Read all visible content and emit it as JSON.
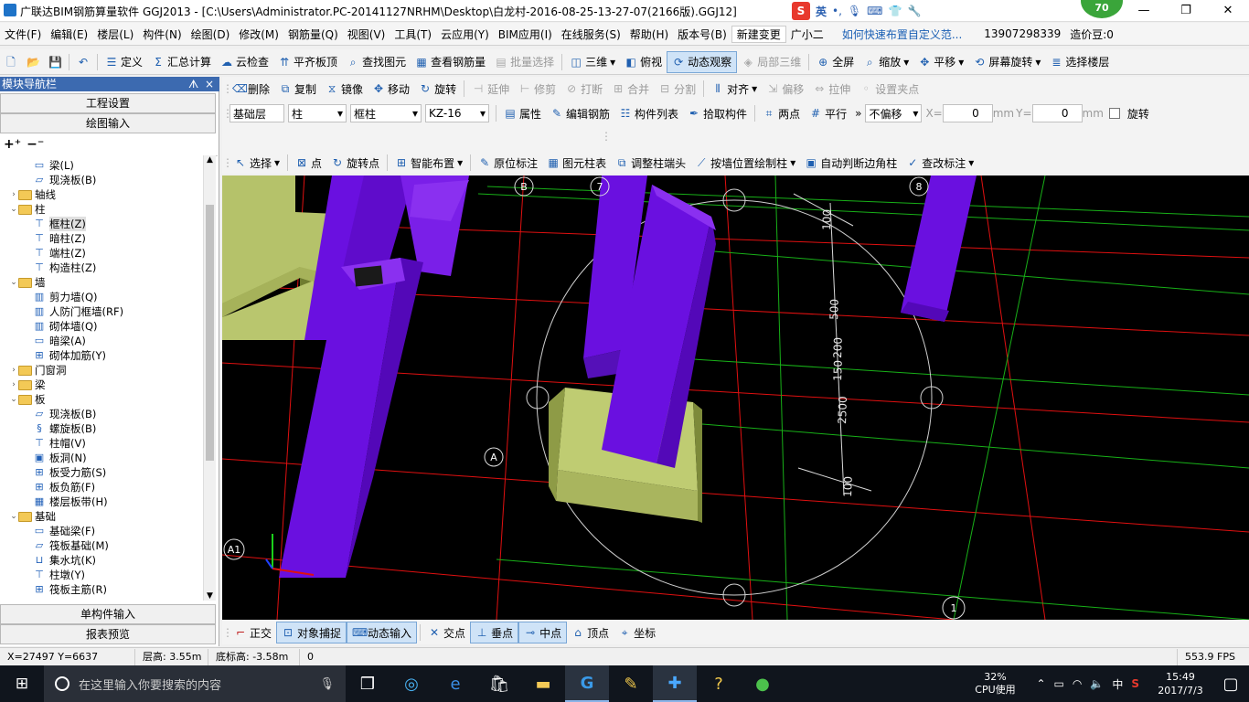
{
  "window": {
    "title": "广联达BIM钢筋算量软件 GGJ2013 - [C:\\Users\\Administrator.PC-20141127NRHM\\Desktop\\白龙村-2016-08-25-13-27-07(2166版).GGJ12]",
    "min": "—",
    "max": "❐",
    "close": "✕",
    "badge": "70",
    "ime_label": "英"
  },
  "menu": [
    "文件(F)",
    "编辑(E)",
    "楼层(L)",
    "构件(N)",
    "绘图(D)",
    "修改(M)",
    "钢筋量(Q)",
    "视图(V)",
    "工具(T)",
    "云应用(Y)",
    "BIM应用(I)",
    "在线服务(S)",
    "帮助(H)",
    "版本号(B)",
    "新建变更",
    "广小二",
    "如何快速布置自定义范...",
    "13907298339",
    "造价豆:0"
  ],
  "toolbar1": [
    "定义",
    "汇总计算",
    "云检查",
    "平齐板顶",
    "查找图元",
    "查看钢筋量",
    "批量选择",
    "三维",
    "俯视",
    "动态观察",
    "局部三维",
    "全屏",
    "缩放",
    "平移",
    "屏幕旋转",
    "选择楼层"
  ],
  "nav": {
    "header": "模块导航栏",
    "pin": "ᗑ",
    "close": "×",
    "buttons": [
      "工程设置",
      "绘图输入"
    ],
    "bottom_buttons": [
      "单构件输入",
      "报表预览"
    ],
    "tree": [
      {
        "level": 2,
        "label": "梁(L)",
        "icon": "beam"
      },
      {
        "level": 2,
        "label": "现浇板(B)",
        "icon": "slab"
      },
      {
        "level": 1,
        "label": "轴线",
        "exp": "›"
      },
      {
        "level": 1,
        "label": "柱",
        "exp": "⌄"
      },
      {
        "level": 2,
        "label": "框柱(Z)",
        "icon": "column",
        "selected": true
      },
      {
        "level": 2,
        "label": "暗柱(Z)",
        "icon": "column"
      },
      {
        "level": 2,
        "label": "端柱(Z)",
        "icon": "column"
      },
      {
        "level": 2,
        "label": "构造柱(Z)",
        "icon": "column"
      },
      {
        "level": 1,
        "label": "墙",
        "exp": "⌄"
      },
      {
        "level": 2,
        "label": "剪力墙(Q)",
        "icon": "wall"
      },
      {
        "level": 2,
        "label": "人防门框墙(RF)",
        "icon": "wall"
      },
      {
        "level": 2,
        "label": "砌体墙(Q)",
        "icon": "wall"
      },
      {
        "level": 2,
        "label": "暗梁(A)",
        "icon": "beam"
      },
      {
        "level": 2,
        "label": "砌体加筋(Y)",
        "icon": "rebar"
      },
      {
        "level": 1,
        "label": "门窗洞",
        "exp": "›"
      },
      {
        "level": 1,
        "label": "梁",
        "exp": "›"
      },
      {
        "level": 1,
        "label": "板",
        "exp": "⌄"
      },
      {
        "level": 2,
        "label": "现浇板(B)",
        "icon": "slab"
      },
      {
        "level": 2,
        "label": "螺旋板(B)",
        "icon": "spiral"
      },
      {
        "level": 2,
        "label": "柱帽(V)",
        "icon": "cap"
      },
      {
        "level": 2,
        "label": "板洞(N)",
        "icon": "hole"
      },
      {
        "level": 2,
        "label": "板受力筋(S)",
        "icon": "rebar"
      },
      {
        "level": 2,
        "label": "板负筋(F)",
        "icon": "rebar"
      },
      {
        "level": 2,
        "label": "楼层板带(H)",
        "icon": "band"
      },
      {
        "level": 1,
        "label": "基础",
        "exp": "⌄"
      },
      {
        "level": 2,
        "label": "基础梁(F)",
        "icon": "beam"
      },
      {
        "level": 2,
        "label": "筏板基础(M)",
        "icon": "slab"
      },
      {
        "level": 2,
        "label": "集水坑(K)",
        "icon": "pit"
      },
      {
        "level": 2,
        "label": "柱墩(Y)",
        "icon": "cap"
      },
      {
        "level": 2,
        "label": "筏板主筋(R)",
        "icon": "rebar"
      }
    ]
  },
  "edit_toolbar": [
    "删除",
    "复制",
    "镜像",
    "移动",
    "旋转",
    "延伸",
    "修剪",
    "打断",
    "合并",
    "分割",
    "对齐",
    "偏移",
    "拉伸",
    "设置夹点"
  ],
  "prop_toolbar": {
    "floor": "基础层",
    "category": "柱",
    "type": "框柱",
    "component": "KZ-16",
    "buttons": [
      "属性",
      "编辑钢筋",
      "构件列表",
      "拾取构件",
      "两点",
      "平行"
    ],
    "offset_mode": "不偏移",
    "x_label": "X=",
    "x_value": "0",
    "x_unit": "mm",
    "y_label": "Y=",
    "y_value": "0",
    "y_unit": "mm",
    "rotate_label": "旋转"
  },
  "draw_toolbar": [
    "选择",
    "点",
    "旋转点",
    "智能布置",
    "原位标注",
    "图元柱表",
    "调整柱端头",
    "按墙位置绘制柱",
    "自动判断边角柱",
    "查改标注"
  ],
  "viewport": {
    "axis_labels": [
      "B",
      "7",
      "8",
      "A",
      "A1",
      "1"
    ],
    "dims": [
      "100",
      "500",
      "150",
      "200",
      "2500",
      "100"
    ]
  },
  "snap_toolbar": [
    "正交",
    "对象捕捉",
    "动态输入",
    "交点",
    "垂点",
    "中点",
    "顶点",
    "坐标"
  ],
  "status": {
    "coords": "X=27497 Y=6637",
    "floor_h": "层高: 3.55m",
    "bottom_h": "底标高: -3.58m",
    "val": "0",
    "fps": "553.9 FPS"
  },
  "taskbar": {
    "search_placeholder": "在这里输入你要搜索的内容",
    "cpu": "32%",
    "cpu_label": "CPU使用",
    "time": "15:49",
    "date": "2017/7/3",
    "ime": "中"
  }
}
